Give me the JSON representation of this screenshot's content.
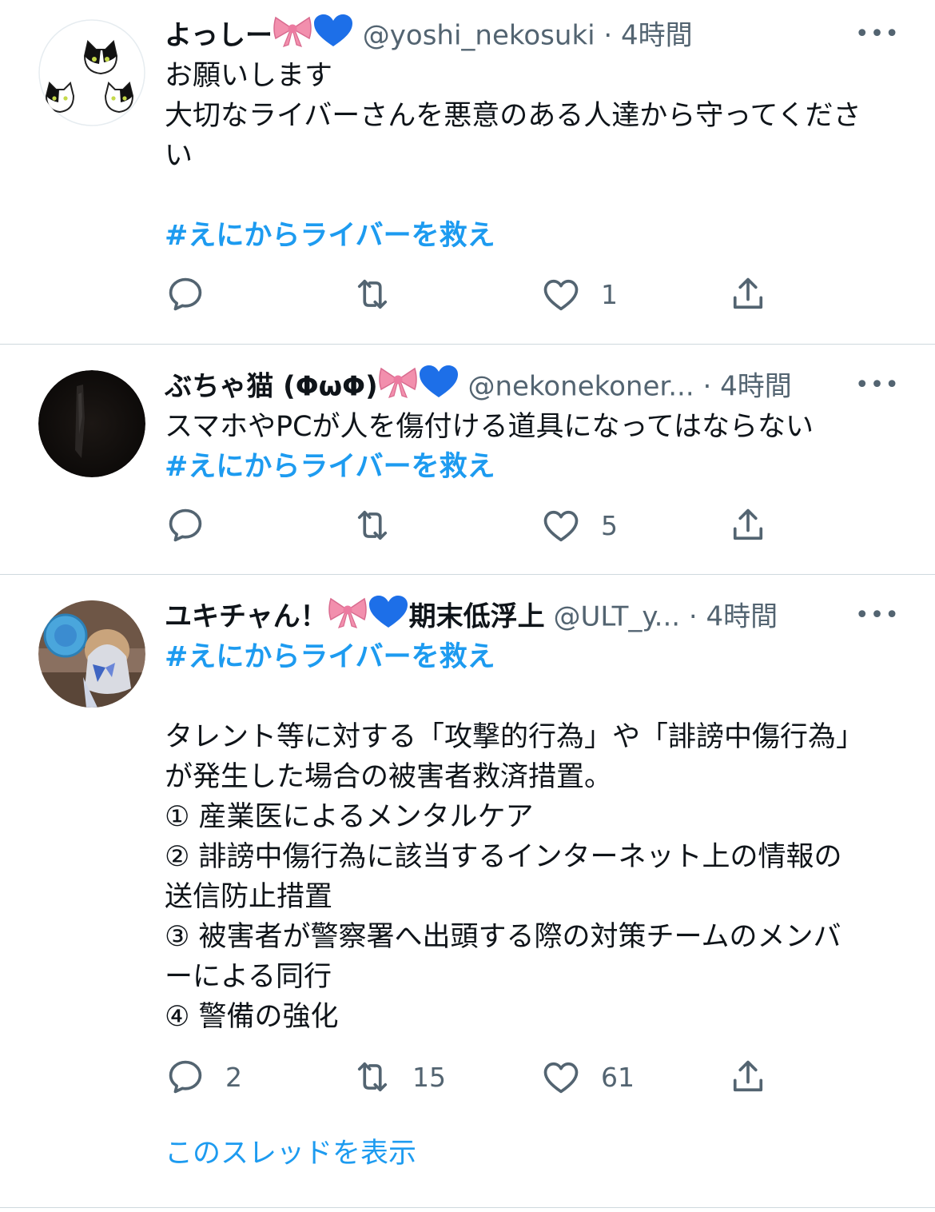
{
  "tweets": [
    {
      "name": "よっしー",
      "name_suffix": "",
      "handle": "@yoshi_nekosuki",
      "sep": "·",
      "time": "4時間",
      "more": "•••",
      "lines": [
        "お願いします",
        "大切なライバーさんを悪意のある人達から守ってくださ",
        "い",
        "",
        "#えにからライバーを救え"
      ],
      "reply_count": "",
      "retweet_count": "",
      "like_count": "1"
    },
    {
      "name": "ぶちゃ猫 (ΦωΦ)",
      "name_suffix": "",
      "handle": "@nekonekoner...",
      "sep": "·",
      "time": "4時間",
      "more": "•••",
      "lines": [
        "スマホやPCが人を傷付ける道具になってはならない",
        "#えにからライバーを救え"
      ],
      "reply_count": "",
      "retweet_count": "",
      "like_count": "5"
    },
    {
      "name": "ユキチャん！",
      "name_suffix": "期末低浮上",
      "handle": "@ULT_y...",
      "sep": "·",
      "time": "4時間",
      "more": "•••",
      "lines": [
        "#えにからライバーを救え",
        "",
        "タレント等に対する「攻撃的行為」や「誹謗中傷行為」",
        "が発生した場合の被害者救済措置。",
        " ① 産業医によるメンタルケア",
        " ② 誹謗中傷行為に該当するインターネット上の情報の",
        "送信防止措置",
        " ③ 被害者が警察署へ出頭する際の対策チームのメンバ",
        "ーによる同行",
        " ④ 警備の強化"
      ],
      "reply_count": "2",
      "retweet_count": "15",
      "like_count": "61"
    }
  ],
  "show_thread": "このスレッドを表示",
  "colors": {
    "link": "#1d9bf0",
    "muted": "#536471",
    "divider": "#cfd9de",
    "bow": "#f28fad",
    "heart": "#1d6fe8"
  },
  "icons": [
    "ribbon-emoji-icon",
    "blue-heart-emoji-icon",
    "reply-icon",
    "retweet-icon",
    "like-icon",
    "share-icon",
    "more-icon"
  ]
}
